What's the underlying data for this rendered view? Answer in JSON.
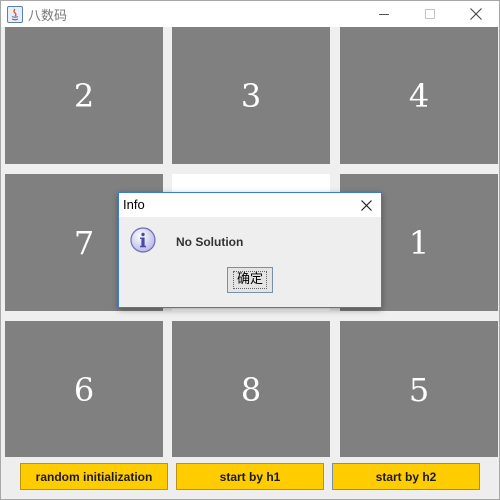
{
  "window": {
    "title": "八数码"
  },
  "board": {
    "tiles": [
      "2",
      "3",
      "4",
      "7",
      "",
      "1",
      "6",
      "8",
      "5"
    ],
    "tile_color": "#808080",
    "blank_color": "#ffffff"
  },
  "controls": {
    "random_label": "random initialization",
    "h1_label": "start by h1",
    "h2_label": "start by h2",
    "button_color": "#ffcc00"
  },
  "dialog": {
    "title": "Info",
    "message": "No Solution",
    "ok_label": "确定",
    "icon": "info-icon"
  }
}
